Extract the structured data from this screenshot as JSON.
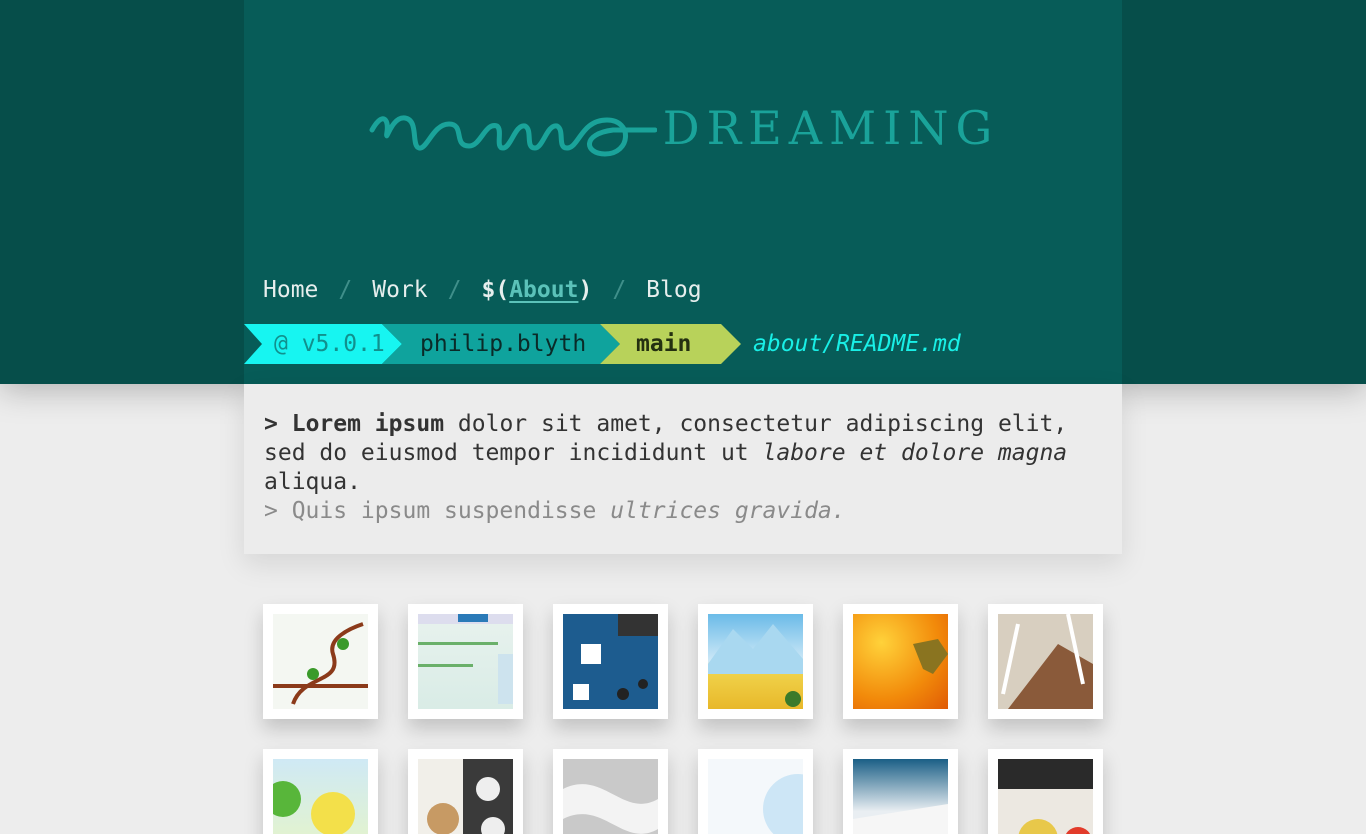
{
  "logo": {
    "script_text": "nemo",
    "word_text": "DREAMING"
  },
  "nav": {
    "items": [
      {
        "label": "Home"
      },
      {
        "label": "Work"
      },
      {
        "prefix": "$(",
        "label": "About",
        "suffix": ")"
      },
      {
        "label": "Blog"
      }
    ],
    "separator": "/"
  },
  "prompt": {
    "version": "@ v5.0.1",
    "user": "philip.blyth",
    "branch": "main",
    "path": "about/README.md"
  },
  "content": {
    "line1_marker": ">",
    "line1_bold": "Lorem ipsum",
    "line1_text": "dolor sit amet, consectetur adipiscing elit, sed do eiusmod tempor incididunt ut",
    "line1_italic": "labore et dolore magna",
    "line1_end": "aliqua.",
    "line2_text": "> Quis ipsum suspendisse",
    "line2_italic": "ultrices gravida."
  },
  "colors": {
    "band": "#064e4a",
    "panel": "#075c58",
    "prompt_version": "#17f5f1",
    "prompt_user": "#0fa39d",
    "prompt_branch": "#b8d25a",
    "path": "#19efe6"
  },
  "gallery": {
    "thumbnails": [
      {
        "icon": "vine-illustration"
      },
      {
        "icon": "website-screenshot"
      },
      {
        "icon": "blue-diagram"
      },
      {
        "icon": "mountain-landscape"
      },
      {
        "icon": "orange-abstract"
      },
      {
        "icon": "building-photo"
      },
      {
        "icon": "yellow-bird"
      },
      {
        "icon": "teddy-bear-pattern"
      },
      {
        "icon": "grey-ribbon"
      },
      {
        "icon": "blue-white-shape"
      },
      {
        "icon": "business-cards"
      },
      {
        "icon": "typography-plate"
      }
    ]
  }
}
